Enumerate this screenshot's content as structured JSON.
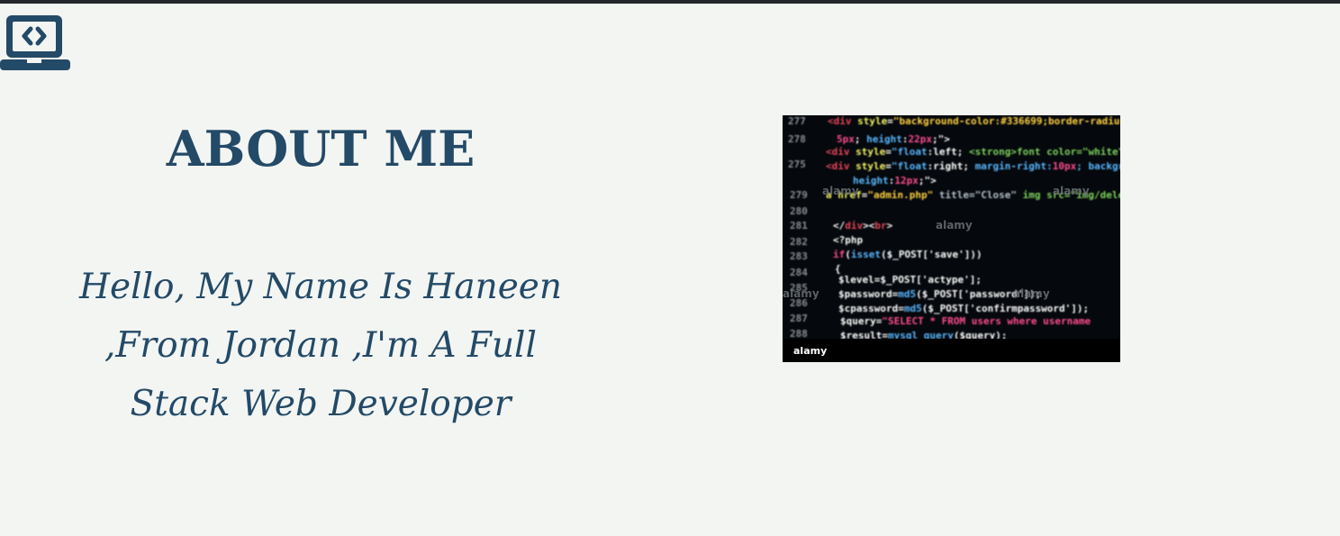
{
  "header": {
    "logo_icon": "laptop-code-icon",
    "brand_color": "#234a67",
    "topbar_color": "#23272b"
  },
  "about": {
    "title": "ABOUT ME",
    "intro": "Hello, My Name Is Haneen ,From Jordan ,I'm A Full Stack Web Developer"
  },
  "image": {
    "description_icon": "code-screen-image",
    "watermark": "alamy"
  }
}
